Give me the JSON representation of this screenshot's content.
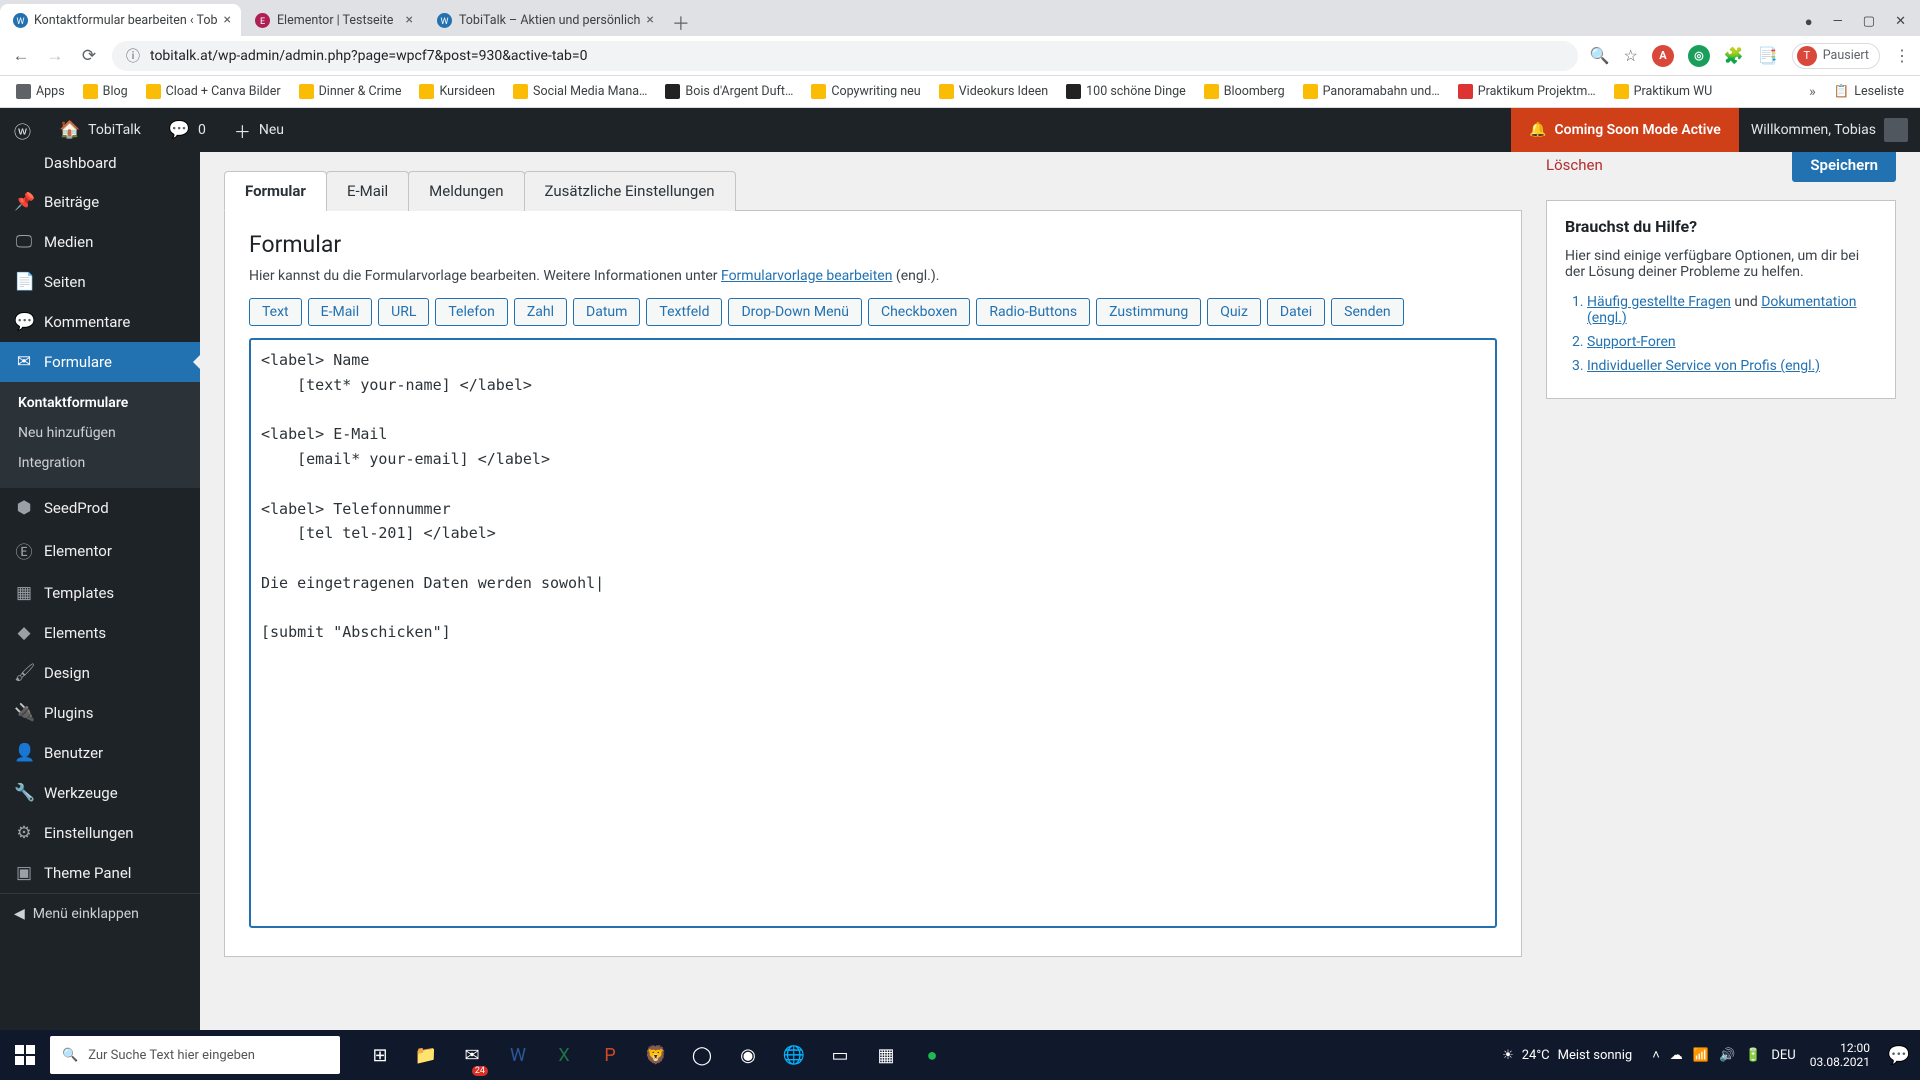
{
  "browser": {
    "tabs": [
      {
        "favicon": "W",
        "faviconColor": "#2271b1",
        "title": "Kontaktformular bearbeiten ‹ Tob"
      },
      {
        "favicon": "E",
        "faviconColor": "#ae2052",
        "title": "Elementor | Testseite"
      },
      {
        "favicon": "W",
        "faviconColor": "#2271b1",
        "title": "TobiTalk – Aktien und persönlich"
      }
    ],
    "url": "tobitalk.at/wp-admin/admin.php?page=wpcf7&post=930&active-tab=0",
    "paused": "Pausiert",
    "bookmarks": [
      "Apps",
      "Blog",
      "Cload + Canva Bilder",
      "Dinner & Crime",
      "Kursideen",
      "Social Media Mana…",
      "Bois d'Argent Duft…",
      "Copywriting neu",
      "Videokurs Ideen",
      "100 schöne Dinge",
      "Bloomberg",
      "Panoramabahn und…",
      "Praktikum Projektm…",
      "Praktikum WU"
    ],
    "readlist": "Leseliste"
  },
  "wpbar": {
    "site": "TobiTalk",
    "comments": "0",
    "new": "Neu",
    "comingSoon": "Coming Soon Mode Active",
    "welcome": "Willkommen, Tobias"
  },
  "sidebar": {
    "dashboard": "Dashboard",
    "items": [
      {
        "icon": "📌",
        "label": "Beiträge"
      },
      {
        "icon": "🖵",
        "label": "Medien"
      },
      {
        "icon": "📄",
        "label": "Seiten"
      },
      {
        "icon": "💬",
        "label": "Kommentare"
      }
    ],
    "formulare": {
      "icon": "✉",
      "label": "Formulare"
    },
    "subs": [
      "Kontaktformulare",
      "Neu hinzufügen",
      "Integration"
    ],
    "rest": [
      {
        "icon": "⬢",
        "label": "SeedProd"
      },
      {
        "icon": "Ⓔ",
        "label": "Elementor"
      },
      {
        "icon": "▦",
        "label": "Templates"
      },
      {
        "icon": "◆",
        "label": "Elements"
      },
      {
        "icon": "🖌",
        "label": "Design"
      },
      {
        "icon": "🔌",
        "label": "Plugins"
      },
      {
        "icon": "👤",
        "label": "Benutzer"
      },
      {
        "icon": "🔧",
        "label": "Werkzeuge"
      },
      {
        "icon": "⚙",
        "label": "Einstellungen"
      },
      {
        "icon": "▣",
        "label": "Theme Panel"
      }
    ],
    "collapse": "Menü einklappen"
  },
  "cf7": {
    "tabs": [
      "Formular",
      "E-Mail",
      "Meldungen",
      "Zusätzliche Einstellungen"
    ],
    "heading": "Formular",
    "descPre": "Hier kannst du die Formularvorlage bearbeiten. Weitere Informationen unter ",
    "descLink": "Formularvorlage bearbeiten",
    "descPost": " (engl.).",
    "tags": [
      "Text",
      "E-Mail",
      "URL",
      "Telefon",
      "Zahl",
      "Datum",
      "Textfeld",
      "Drop-Down Menü",
      "Checkboxen",
      "Radio-Buttons",
      "Zustimmung",
      "Quiz",
      "Datei",
      "Senden"
    ],
    "content": "<label> Name\n    [text* your-name] </label>\n\n<label> E-Mail\n    [email* your-email] </label>\n\n<label> Telefonnummer\n    [tel tel-201] </label>\n\nDie eingetragenen Daten werden sowohl|\n\n[submit \"Abschicken\"]"
  },
  "actions": {
    "delete": "Löschen",
    "save": "Speichern"
  },
  "help": {
    "title": "Brauchst du Hilfe?",
    "intro": "Hier sind einige verfügbare Optionen, um dir bei der Lösung deiner Probleme zu helfen.",
    "items": [
      {
        "link": "Häufig gestellte Fragen",
        "after": " und "
      },
      {
        "link": "Dokumentation (engl.)",
        "after": "",
        "cont": true
      },
      {
        "link": "Support-Foren",
        "after": ""
      },
      {
        "link": "Individueller Service von Profis (engl.)",
        "after": ""
      }
    ]
  },
  "taskbar": {
    "searchPlaceholder": "Zur Suche Text hier eingeben",
    "weatherTemp": "24°C",
    "weatherText": "Meist sonnig",
    "mailBadge": "24",
    "lang": "DEU",
    "time": "12:00",
    "date": "03.08.2021"
  }
}
